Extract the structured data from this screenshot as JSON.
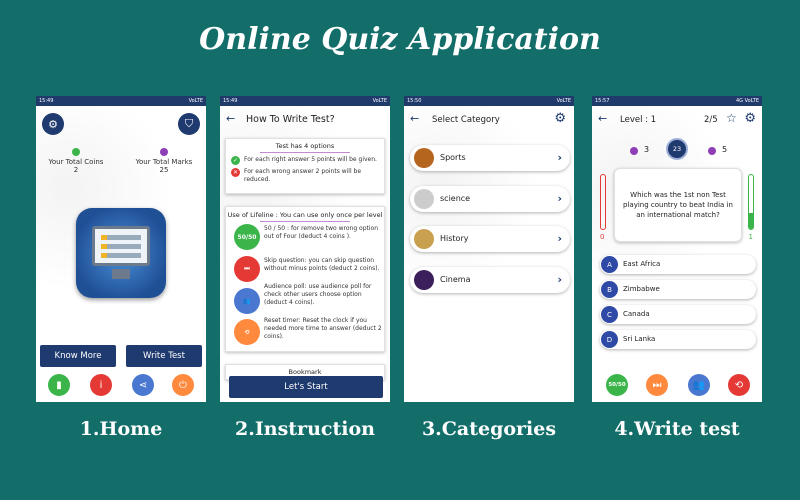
{
  "title": "Online Quiz Application",
  "captions": [
    "1.Home",
    "2.Instruction",
    "3.Categories",
    "4.Write test"
  ],
  "home": {
    "time": "15:49",
    "status": "VoLTE",
    "coins_label": "Your Total Coins",
    "coins_value": "2",
    "marks_label": "Your Total Marks",
    "marks_value": "25",
    "know_more": "Know More",
    "write_test": "Write Test"
  },
  "instruction": {
    "time": "15:49",
    "status": "VoLTE",
    "title": "How To Write Test?",
    "options_heading": "Test has 4 options",
    "right_answer": "For each right answer 5 points will be given.",
    "wrong_answer": "For each wrong answer 2 points will be reduced.",
    "lifeline_heading": "Use of Lifeline : You can use only once per level",
    "fifty_icon": "50/50",
    "fifty_text": "50 / 50 : for remove two wrong option out of Four (deduct 4 coins ).",
    "skip_text": "Skip question: you can skip question without minus points (deduct 2 coins).",
    "poll_text": "Audience poll: use audience poll for check other users choose option (deduct 4 coins).",
    "reset_text": "Reset timer: Reset the clock if you needed more time to answer (deduct 2 coins).",
    "bookmark": "Bookmark",
    "start_button": "Let's Start"
  },
  "categories": {
    "time": "15:50",
    "status": "VoLTE",
    "title": "Select Category",
    "items": [
      {
        "label": "Sports",
        "color": "#b5651d"
      },
      {
        "label": "science",
        "color": "#cccccc"
      },
      {
        "label": "History",
        "color": "#c8a050"
      },
      {
        "label": "Cinema",
        "color": "#3a1f5a"
      }
    ]
  },
  "write_test": {
    "time": "15:57",
    "status": "4G VoLTE",
    "level": "Level : 1",
    "progress": "2/5",
    "coins": "3",
    "timer": "23",
    "marks": "5",
    "question": "Which was the 1st non Test playing country to beat India in an international match?",
    "wrong_count": "0",
    "right_count": "1",
    "options": [
      {
        "letter": "A",
        "text": "East Africa"
      },
      {
        "letter": "B",
        "text": "Zimbabwe"
      },
      {
        "letter": "C",
        "text": "Canada"
      },
      {
        "letter": "D",
        "text": "Sri Lanka"
      }
    ],
    "fifty_label": "50/50"
  },
  "colors": {
    "background": "#136e6a",
    "navy": "#1f3a6e",
    "green": "#3bb54a",
    "red": "#e53935",
    "blue": "#4a78d0",
    "orange": "#ff8a3d",
    "purple": "#8e3fb5"
  }
}
